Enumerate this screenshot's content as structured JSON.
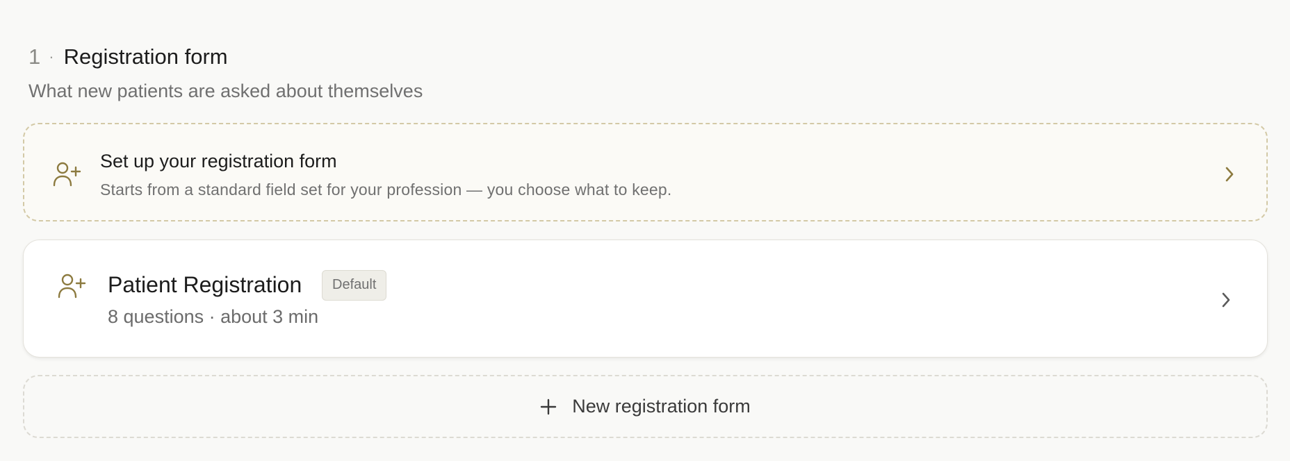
{
  "section": {
    "number": "1",
    "separator": "·",
    "title": "Registration form",
    "subtitle": "What new patients are asked about themselves"
  },
  "setup_card": {
    "title": "Set up your registration form",
    "description": "Starts from a standard field set for your profession — you choose what to keep.",
    "icon": "user-plus-icon",
    "accent_color": "#8c7a3f"
  },
  "forms": [
    {
      "name": "Patient Registration",
      "badge": "Default",
      "meta": "8 questions · about 3 min",
      "icon": "user-plus-icon"
    }
  ],
  "new_form": {
    "label": "New registration form",
    "icon": "plus-icon"
  }
}
